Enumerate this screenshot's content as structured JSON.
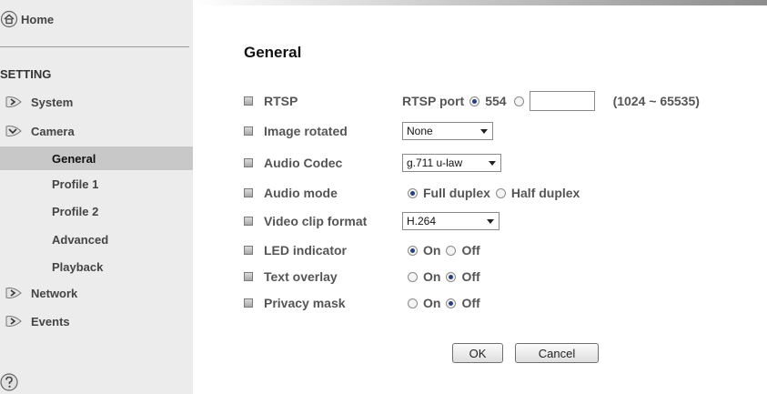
{
  "sidebar": {
    "home_label": "Home",
    "setting_label": "SETTING",
    "menu": {
      "system": "System",
      "camera": "Camera",
      "network": "Network",
      "events": "Events"
    },
    "camera_sub": {
      "general": "General",
      "profile1": "Profile 1",
      "profile2": "Profile 2",
      "advanced": "Advanced",
      "playback": "Playback"
    }
  },
  "main": {
    "title": "General",
    "rtsp": {
      "label": "RTSP",
      "port_label": "RTSP port",
      "default_port": "554",
      "custom_value": "",
      "range": "(1024 ~ 65535)"
    },
    "image_rotated": {
      "label": "Image rotated",
      "value": "None"
    },
    "audio_codec": {
      "label": "Audio Codec",
      "value": "g.711 u-law"
    },
    "audio_mode": {
      "label": "Audio mode",
      "option1": "Full duplex",
      "option2": "Half duplex"
    },
    "video_clip_format": {
      "label": "Video clip format",
      "value": "H.264"
    },
    "led_indicator": {
      "label": "LED indicator",
      "on": "On",
      "off": "Off"
    },
    "text_overlay": {
      "label": "Text overlay",
      "on": "On",
      "off": "Off"
    },
    "privacy_mask": {
      "label": "Privacy mask",
      "on": "On",
      "off": "Off"
    },
    "ok_label": "OK",
    "cancel_label": "Cancel"
  }
}
